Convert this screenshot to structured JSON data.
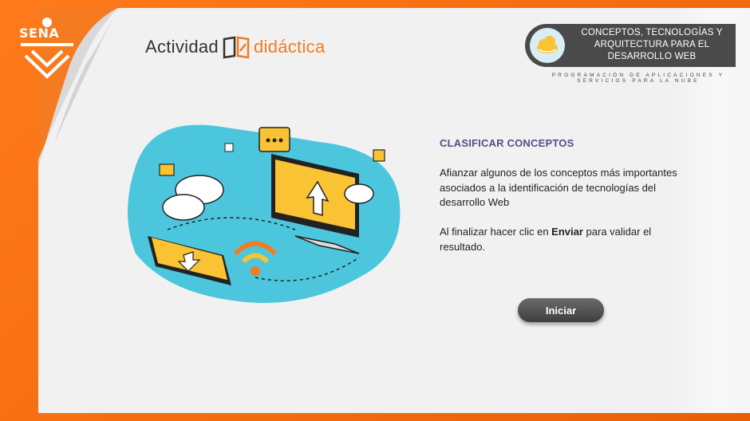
{
  "brand": {
    "logo_text": "SENA"
  },
  "activity": {
    "word1": "Actividad",
    "word2": "didáctica"
  },
  "course": {
    "title_line1": "CONCEPTOS, TECNOLOGÍAS Y",
    "title_line2": "ARQUITECTURA PARA EL",
    "title_line3": "DESARROLLO WEB",
    "program_line1": "PROGRAMACIÓN DE APLICACIONES Y",
    "program_line2": "SERVICIOS PARA LA NUBE"
  },
  "content": {
    "heading": "CLASIFICAR CONCEPTOS",
    "paragraph1": "Afianzar algunos de los conceptos más importantes asociados a la identificación de tecnologías del desarrollo Web",
    "paragraph2_before": "Al finalizar hacer clic en ",
    "paragraph2_bold": "Enviar",
    "paragraph2_after": " para validar el resultado."
  },
  "start_button": {
    "label": "Iniciar"
  },
  "colors": {
    "frame": "#f47b20",
    "accent_text": "#5b4a86",
    "blob": "#4cc6dc",
    "yellow": "#f9c333",
    "badge": "#4a4a4a"
  },
  "icons": [
    "sena-logo-icon",
    "book-icon",
    "cloud-icon"
  ]
}
